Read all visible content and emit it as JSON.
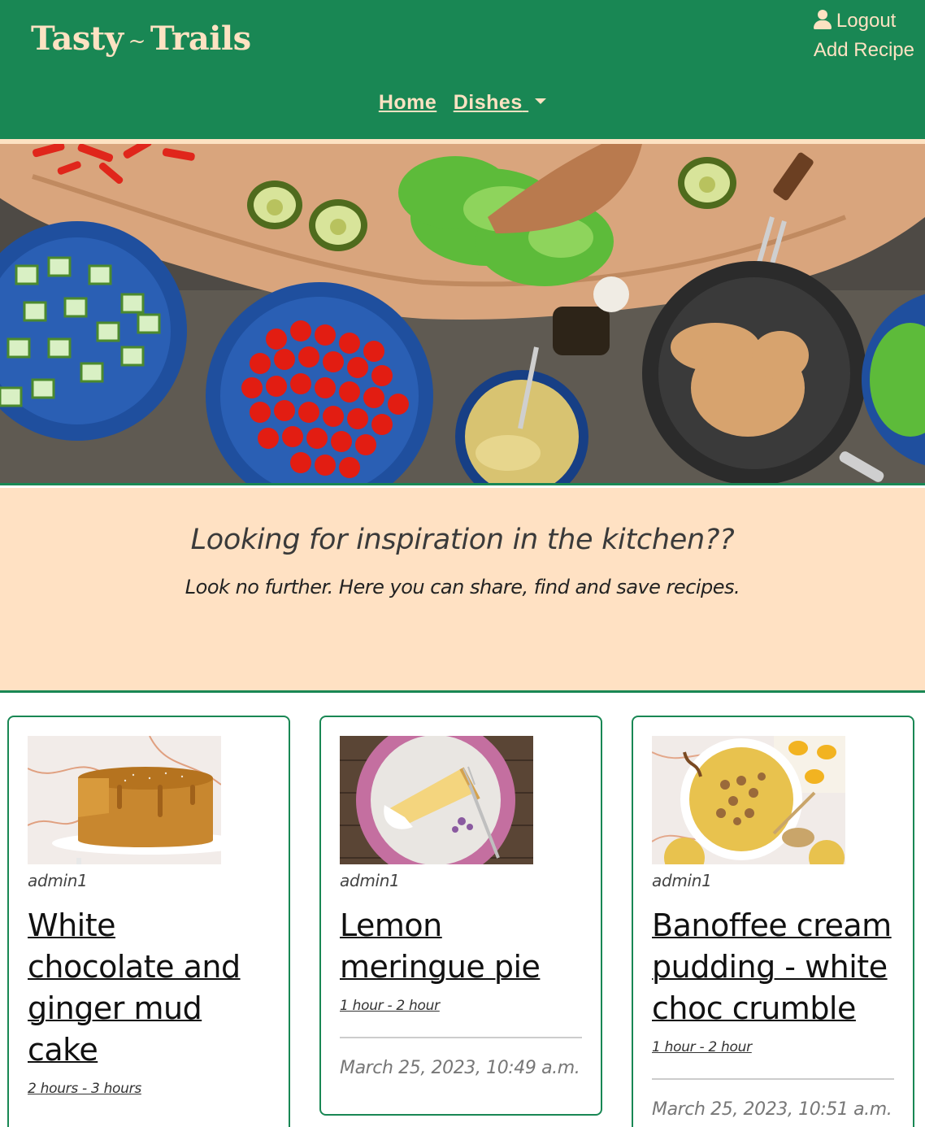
{
  "header": {
    "brand_left": "Tasty",
    "brand_sep": "~",
    "brand_right": "Trails",
    "logout_label": "Logout",
    "add_recipe_label": "Add Recipe",
    "nav": {
      "home": "Home",
      "dishes": "Dishes"
    }
  },
  "intro": {
    "heading": "Looking for inspiration in the kitchen??",
    "subheading": "Look no further. Here you can share, find and save recipes."
  },
  "recipes": [
    {
      "author": "admin1",
      "title": "White chocolate and ginger mud cake",
      "time": "2 hours - 3 hours",
      "date": ""
    },
    {
      "author": "admin1",
      "title": "Lemon meringue pie",
      "time": "1 hour - 2 hour",
      "date": "March 25, 2023, 10:49 a.m."
    },
    {
      "author": "admin1",
      "title": "Banoffee cream pudding - white choc crumble",
      "time": "1 hour - 2 hour",
      "date": "March 25, 2023, 10:51 a.m."
    }
  ],
  "colors": {
    "primary": "#198754",
    "accent": "#fde2c2",
    "intro_bg": "#ffe1c3"
  }
}
